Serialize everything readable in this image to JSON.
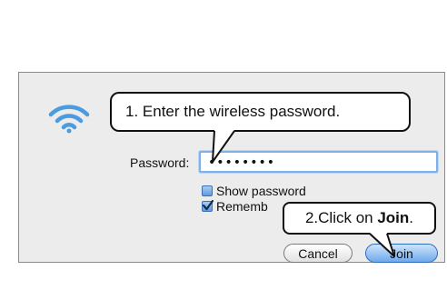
{
  "dialog": {
    "password_label": "Password:",
    "password_value": "••••••••",
    "show_password_label": "Show password",
    "show_password_checked": false,
    "remember_label": "Rememb",
    "remember_checked": true,
    "cancel_label": "Cancel",
    "join_label": "Join"
  },
  "annotations": {
    "step1": "1. Enter the wireless password.",
    "step2_prefix": "2.Click on ",
    "step2_bold": "Join",
    "step2_suffix": "."
  },
  "icons": {
    "wifi": "wifi-icon",
    "checkmark": "checkmark-icon"
  },
  "colors": {
    "dialog_bg": "#ececec",
    "wifi_blue": "#4a9be0",
    "focus_blue": "#7fb0e8",
    "join_blue": "#6fa9ec"
  }
}
